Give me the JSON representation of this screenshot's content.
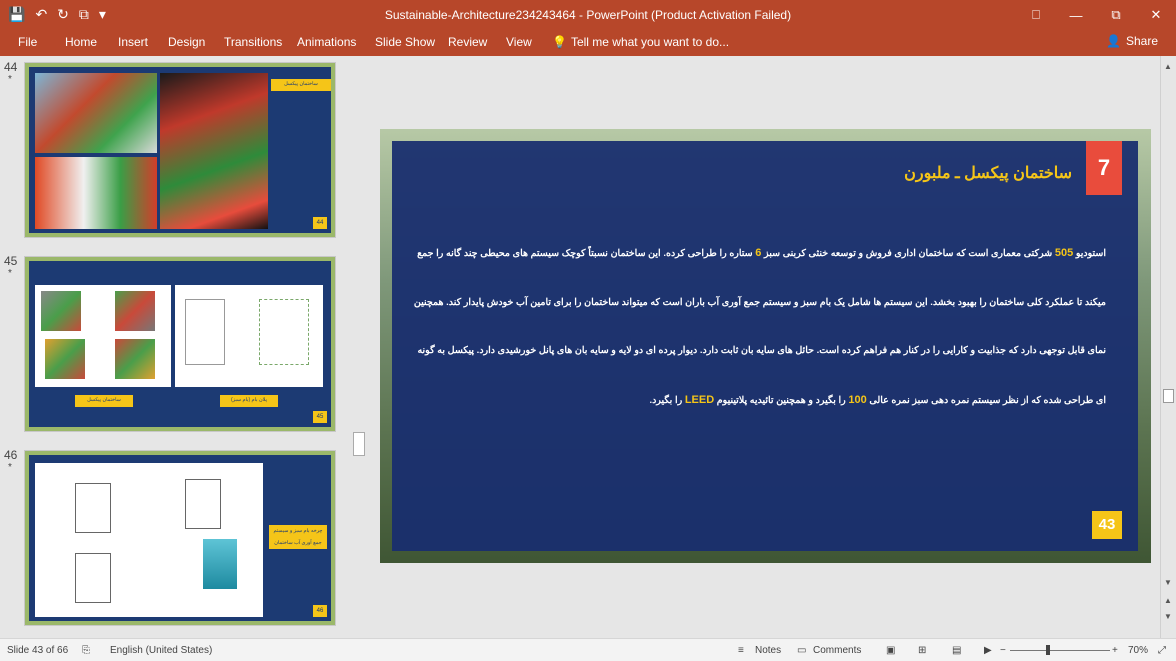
{
  "titlebar": {
    "title": "Sustainable-Architecture234243464 - PowerPoint (Product Activation Failed)",
    "qat": [
      "💾",
      "↶",
      "↻",
      "⧉",
      "▾"
    ],
    "window_controls": [
      "⎕",
      "—",
      "⧉",
      "✕"
    ]
  },
  "ribbon": {
    "tabs": [
      "File",
      "Home",
      "Insert",
      "Design",
      "Transitions",
      "Animations",
      "Slide Show",
      "Review",
      "View"
    ],
    "tell_me": "Tell me what you want to do...",
    "share": "Share"
  },
  "thumbnails": [
    {
      "number": "44",
      "star": "*",
      "caption": "ساختمان پیکسل",
      "page": "44"
    },
    {
      "number": "45",
      "star": "*",
      "caption_a": "ساختمان پیکسل",
      "caption_b": "پلان بام (بام سبز)",
      "page": "45"
    },
    {
      "number": "46",
      "star": "*",
      "caption": "چرخه بام سبز و سیستم جمع آوری آب ساختمان",
      "page": "46"
    }
  ],
  "slide": {
    "number_badge": "7",
    "heading": "ساختمان پیکسل ـ ملبورن",
    "body_parts": [
      "استودیو ",
      "505",
      " شرکتی معماری است که ساختمان اداری فروش و توسعه خنثی کربنی سبز ",
      "6",
      " ستاره را طراحی کرده. این ساختمان نسبتاً کوچک سیستم های محیطی چند گانه را جمع میکند تا عملکرد کلی ساختمان را بهبود بخشد. این سیستم ها شامل یک بام سبز و سیستم جمع آوری آب باران است که میتواند ساختمان را برای تامین آب خودش پایدار کند. همچنین نمای قابل توجهی دارد که جذابیت و کارایی را در کنار هم فراهم کرده است. حائل های سایه بان ثابت دارد. دیوار پرده ای دو لایه و سایه بان های پانل خورشیدی دارد. پیکسل به گونه ای طراحی شده که از نظر سیستم نمره دهی سبز نمره عالی ",
      "100",
      " را بگیرد و همچنین تائیدیه پلاتینیوم ",
      "LEED",
      " را بگیرد."
    ],
    "page_number": "43"
  },
  "status": {
    "slide_info": "Slide 43 of 66",
    "language": "English (United States)",
    "notes": "Notes",
    "comments": "Comments",
    "zoom": "70%"
  },
  "colors": {
    "ribbon": "#b7472a",
    "panel": "#182e6e",
    "accent_yellow": "#f5c518",
    "badge_red": "#e94c3c"
  }
}
